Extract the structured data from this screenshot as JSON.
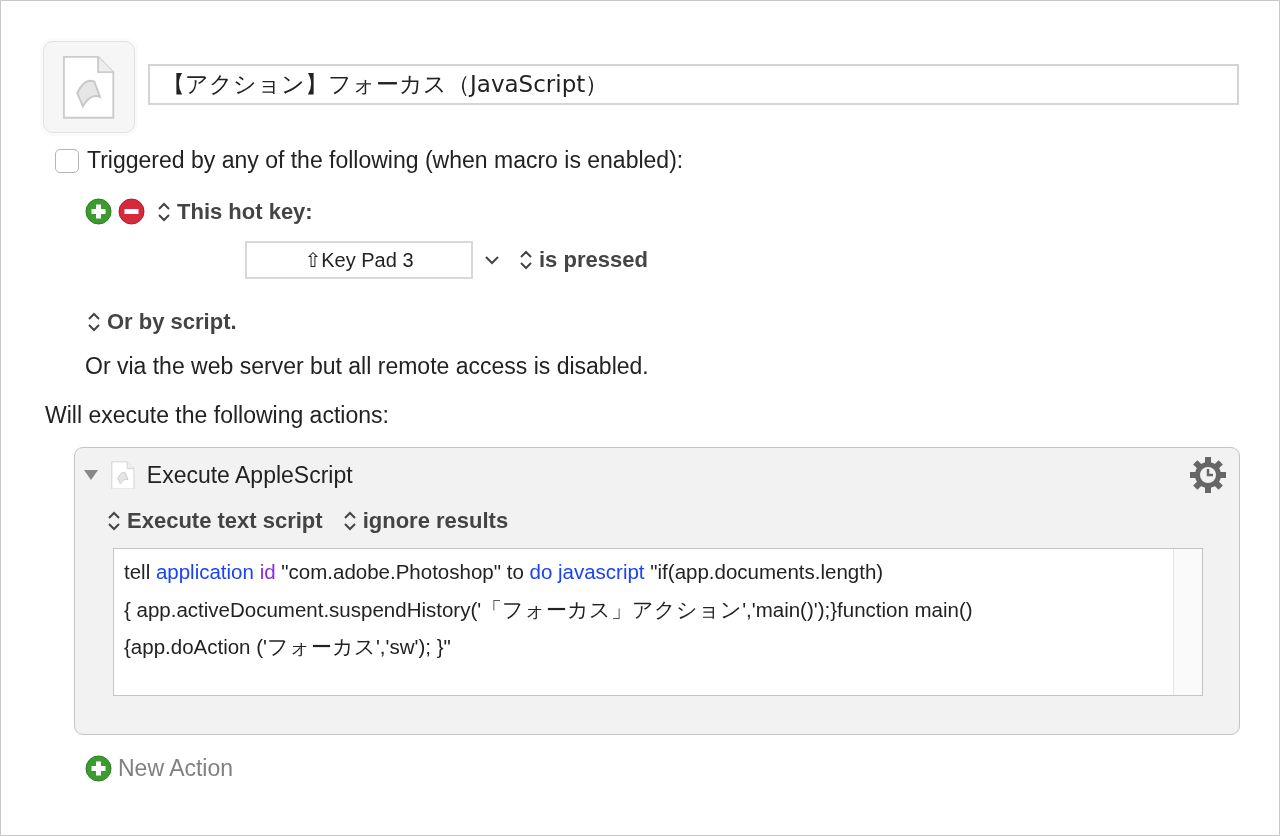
{
  "macro": {
    "title": "【アクション】フォーカス（JavaScript）"
  },
  "trigger": {
    "checked": false,
    "label": "Triggered by any of the following (when macro is enabled):",
    "hot_key": {
      "label": "This hot key:",
      "key": "⇧Key Pad 3",
      "condition": "is pressed"
    },
    "script_option": "Or by script.",
    "web_server_note": "Or via the web server but all remote access is disabled."
  },
  "actions_heading": "Will execute the following actions:",
  "action": {
    "expanded": true,
    "title": "Execute AppleScript",
    "source": "Execute text script",
    "results": "ignore results",
    "script_lines": [
      [
        {
          "kind": "plain",
          "text": "tell "
        },
        {
          "kind": "keyword",
          "text": "application "
        },
        {
          "kind": "property",
          "text": "id"
        },
        {
          "kind": "plain",
          "text": " \"com.adobe.Photoshop\" to "
        },
        {
          "kind": "keyword",
          "text": "do javascript"
        },
        {
          "kind": "plain",
          "text": " \"if(app.documents.length)"
        }
      ],
      [
        {
          "kind": "plain",
          "text": "{ app.activeDocument.suspendHistory('「フォーカス」アクション','main()');}function main()"
        }
      ],
      [
        {
          "kind": "plain",
          "text": "{app.doAction ('フォーカス','sw'); }\""
        }
      ]
    ]
  },
  "new_action": "New Action"
}
